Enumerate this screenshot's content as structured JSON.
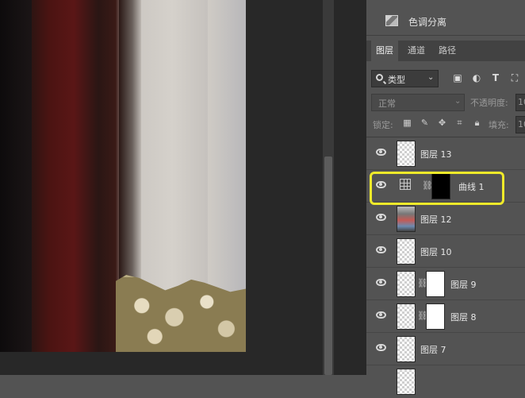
{
  "colors": {
    "panel_bg": "#535353",
    "canvas_bg": "#282828",
    "highlight": "#f0ea2a"
  },
  "adjustment_shortcut": {
    "label": "色调分离",
    "icon": "posterize-icon"
  },
  "tabs": [
    {
      "label": "图层",
      "active": true
    },
    {
      "label": "通道",
      "active": false
    },
    {
      "label": "路径",
      "active": false
    }
  ],
  "filter": {
    "kind_label": "类型",
    "icons": [
      "pixel-filter-icon",
      "adjustment-filter-icon",
      "type-filter-icon",
      "shape-filter-icon"
    ]
  },
  "blend": {
    "mode": "正常",
    "opacity_label": "不透明度:",
    "opacity_value": "10"
  },
  "lock": {
    "label": "锁定:",
    "fill_label": "填充:",
    "fill_value": "10"
  },
  "layers": [
    {
      "name": "图层 13",
      "visible": true,
      "thumb": "transparent"
    },
    {
      "name": "曲线 1",
      "visible": true,
      "thumb": "curves-adjustment",
      "mask": "black",
      "linked": true,
      "selected": true
    },
    {
      "name": "图层 12",
      "visible": true,
      "thumb": "photo"
    },
    {
      "name": "图层 10",
      "visible": true,
      "thumb": "transparent"
    },
    {
      "name": "图层 9",
      "visible": true,
      "thumb": "transparent",
      "mask": "white",
      "linked": true
    },
    {
      "name": "图层 8",
      "visible": true,
      "thumb": "transparent",
      "mask": "white",
      "linked": true
    },
    {
      "name": "图层 7",
      "visible": true,
      "thumb": "transparent"
    }
  ]
}
